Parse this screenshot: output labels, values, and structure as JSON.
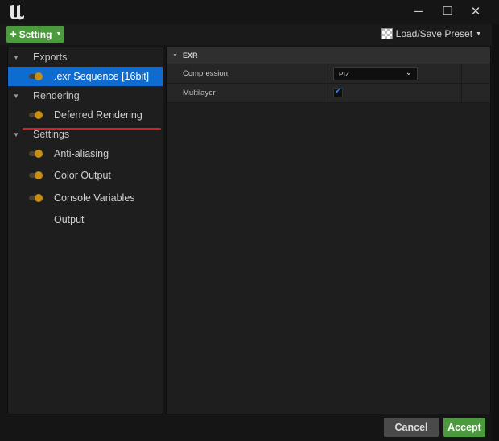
{
  "window": {
    "minimize_glyph": "─",
    "maximize_glyph": "☐",
    "close_glyph": "✕"
  },
  "toolbar": {
    "add_button": {
      "plus": "+",
      "label": "Setting",
      "caret": "▼"
    },
    "preset": {
      "label": "Load/Save Preset",
      "caret": "▼"
    }
  },
  "left_panel": {
    "sections": [
      {
        "label": "Exports",
        "arrow": "▼",
        "items": [
          {
            "label": ".exr Sequence [16bit]",
            "selected": true,
            "toggle": true
          }
        ]
      },
      {
        "label": "Rendering",
        "arrow": "▼",
        "items": [
          {
            "label": "Deferred Rendering",
            "toggle": true
          }
        ]
      },
      {
        "label": "Settings",
        "arrow": "▼",
        "items": [
          {
            "label": "Anti-aliasing",
            "toggle": true
          },
          {
            "label": "Color Output",
            "toggle": true
          },
          {
            "label": "Console Variables",
            "toggle": true
          },
          {
            "label": "Output",
            "toggle": false
          }
        ]
      }
    ]
  },
  "details": {
    "category": {
      "label": "EXR",
      "arrow": "▼"
    },
    "properties": [
      {
        "name": "Compression",
        "value": "PIZ",
        "chevron": "⌄"
      },
      {
        "name": "Multilayer",
        "checked": true,
        "check_glyph": "✔"
      }
    ]
  },
  "footer": {
    "cancel_label": "Cancel",
    "accept_label": "Accept"
  },
  "colors": {
    "accent_green": "#4c9a3e",
    "selection_blue": "#0e6bd0",
    "toggle_orange": "#c98d0f",
    "annotation_red": "#d81f26"
  }
}
